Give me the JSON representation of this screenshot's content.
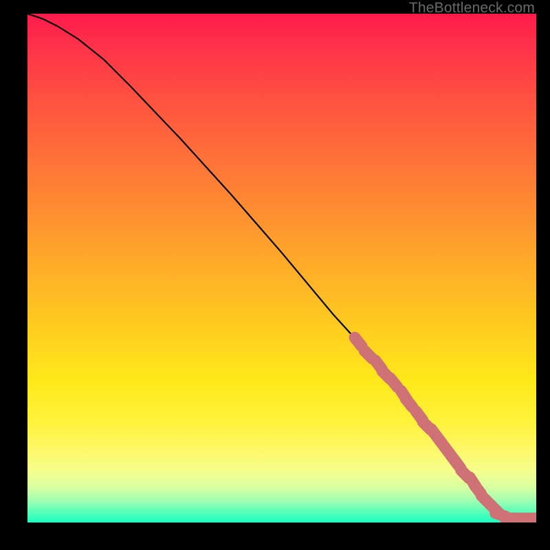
{
  "watermark": "TheBottleneck.com",
  "colors": {
    "curve": "#000000",
    "marker_fill": "#cf7276",
    "marker_stroke": "#b45a5e"
  },
  "chart_data": {
    "type": "line",
    "title": "",
    "xlabel": "",
    "ylabel": "",
    "xlim": [
      0,
      100
    ],
    "ylim": [
      0,
      100
    ],
    "grid": false,
    "legend": false,
    "series": [
      {
        "name": "curve",
        "x": [
          0,
          3,
          6,
          10,
          15,
          20,
          30,
          40,
          50,
          60,
          65,
          70,
          75,
          80,
          85,
          88,
          90,
          92,
          94,
          96,
          98,
          100
        ],
        "y": [
          100,
          99,
          97.5,
          95,
          91,
          86,
          75.5,
          64.5,
          53,
          41,
          35.5,
          30,
          24,
          18,
          12,
          8,
          5.5,
          3.5,
          2,
          1,
          0.8,
          0.8
        ]
      }
    ],
    "markers": [
      {
        "x": 65,
        "y": 35.5
      },
      {
        "x": 67,
        "y": 33
      },
      {
        "x": 69,
        "y": 31
      },
      {
        "x": 70.5,
        "y": 29
      },
      {
        "x": 72,
        "y": 27.5
      },
      {
        "x": 74,
        "y": 25
      },
      {
        "x": 75,
        "y": 23.5
      },
      {
        "x": 77,
        "y": 21
      },
      {
        "x": 78.5,
        "y": 19
      },
      {
        "x": 80,
        "y": 17.5
      },
      {
        "x": 81.5,
        "y": 15.5
      },
      {
        "x": 83,
        "y": 13.5
      },
      {
        "x": 84.5,
        "y": 11.5
      },
      {
        "x": 86,
        "y": 9.5
      },
      {
        "x": 87.5,
        "y": 8
      },
      {
        "x": 88.5,
        "y": 6.5
      },
      {
        "x": 90,
        "y": 4.5
      },
      {
        "x": 91.5,
        "y": 3
      },
      {
        "x": 93,
        "y": 1.5
      },
      {
        "x": 95,
        "y": 0.8
      },
      {
        "x": 97,
        "y": 0.8
      },
      {
        "x": 99.5,
        "y": 0.8
      }
    ]
  }
}
